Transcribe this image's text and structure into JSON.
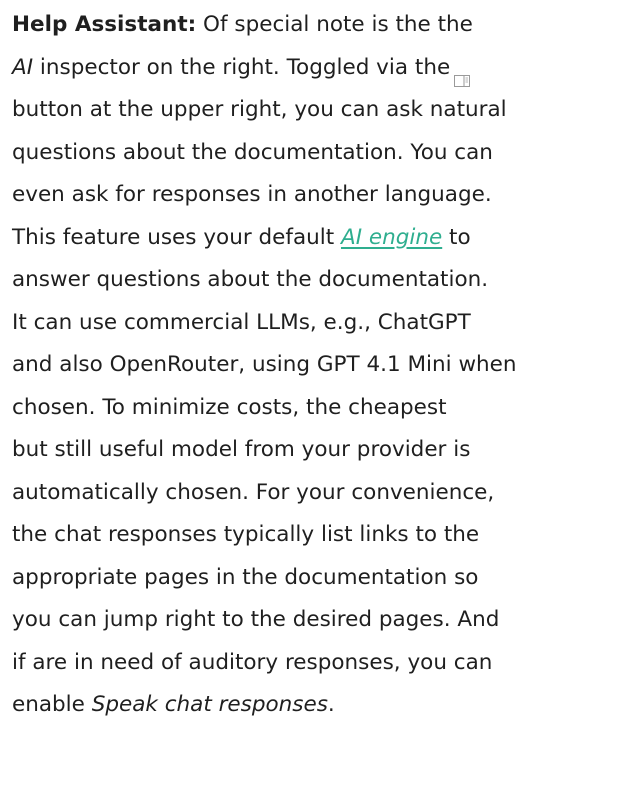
{
  "help": {
    "label": "Help Assistant:",
    "intro": " Of special note is the the",
    "ai_word": "AI",
    "line2": " inspector on the right. Toggled via the",
    "toggle_icon": "sidebar-toggle-icon",
    "line3": "button at the upper right, you can ask natural",
    "line4": "questions about the documentation. You can",
    "line5": "even ask for responses in another language.",
    "line6_before": "This feature uses your default ",
    "link_text": "AI engine",
    "line6_after": " to",
    "line7": "answer questions about the documentation.",
    "line8": "It can use commercial LLMs, e.g., ChatGPT",
    "line9": "and also OpenRouter, using GPT 4.1 Mini when",
    "line10": "chosen. To minimize costs, the cheapest",
    "line11": "but still useful model from your provider is",
    "line12": "automatically chosen. For your convenience,",
    "line13": "the chat responses typically list links to the",
    "line14": "appropriate pages in the documentation so",
    "line15": "you can jump right to the desired pages. And",
    "line16": "if are in need of auditory responses, you can",
    "line17_before": "enable ",
    "speak_text": "Speak chat responses",
    "line17_after": "."
  },
  "colors": {
    "text": "#1f1f1f",
    "link": "#2fae8f"
  }
}
